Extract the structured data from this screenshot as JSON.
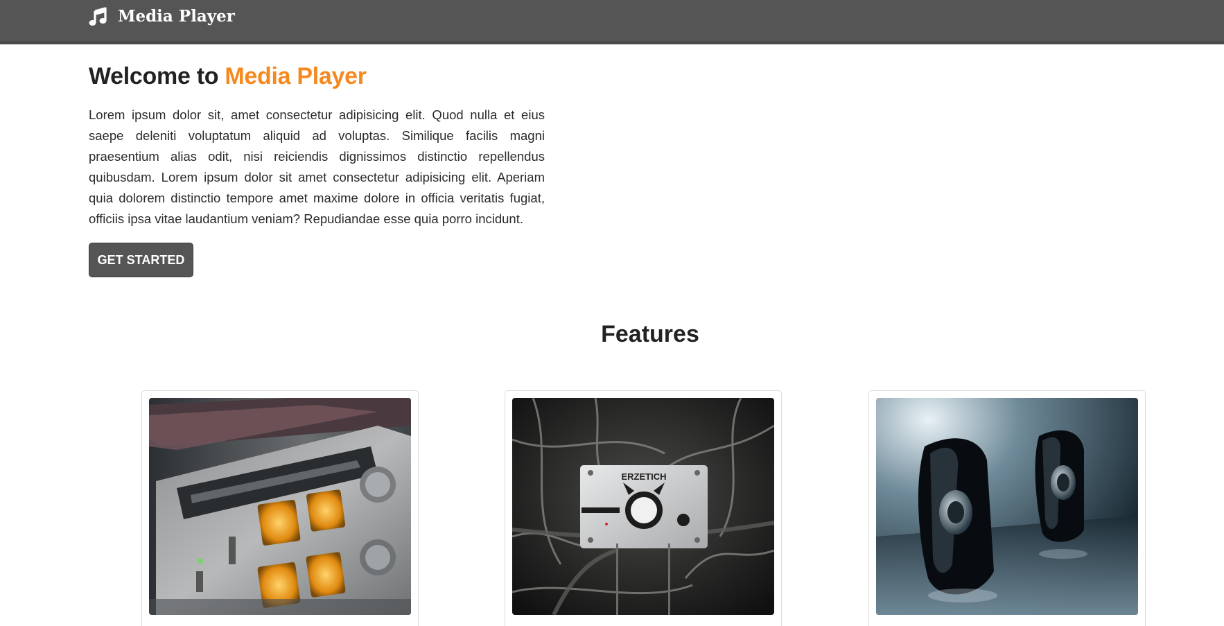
{
  "navbar": {
    "brand_icon": "music-note-icon",
    "title": "Media Player"
  },
  "hero": {
    "title_prefix": "Welcome to",
    "title_accent": "Media Player",
    "accent_color": "#f5891f",
    "paragraph": "Lorem ipsum dolor sit, amet consectetur adipisicing elit. Quod nulla et eius saepe deleniti voluptatum aliquid ad voluptas. Similique facilis magni praesentium alias odit, nisi reiciendis dignissimos distinctio repellendus quibusdam. Lorem ipsum dolor sit amet consectetur adipisicing elit. Aperiam quia dolorem distinctio tempore amet maxime dolore in officia veritatis fugiat, officiis ipsa vitae laudantium veniam? Repudiandae esse quia porro incidunt.",
    "cta_label": "GET STARTED"
  },
  "features": {
    "title": "Features",
    "cards": [
      {
        "image": "vintage-receiver-photo"
      },
      {
        "image": "headphone-amplifier-photo",
        "image_text": "ERZETICH"
      },
      {
        "image": "desktop-speakers-photo"
      }
    ]
  },
  "colors": {
    "navbar": "#555555",
    "button": "#555555",
    "accent": "#f5891f"
  }
}
